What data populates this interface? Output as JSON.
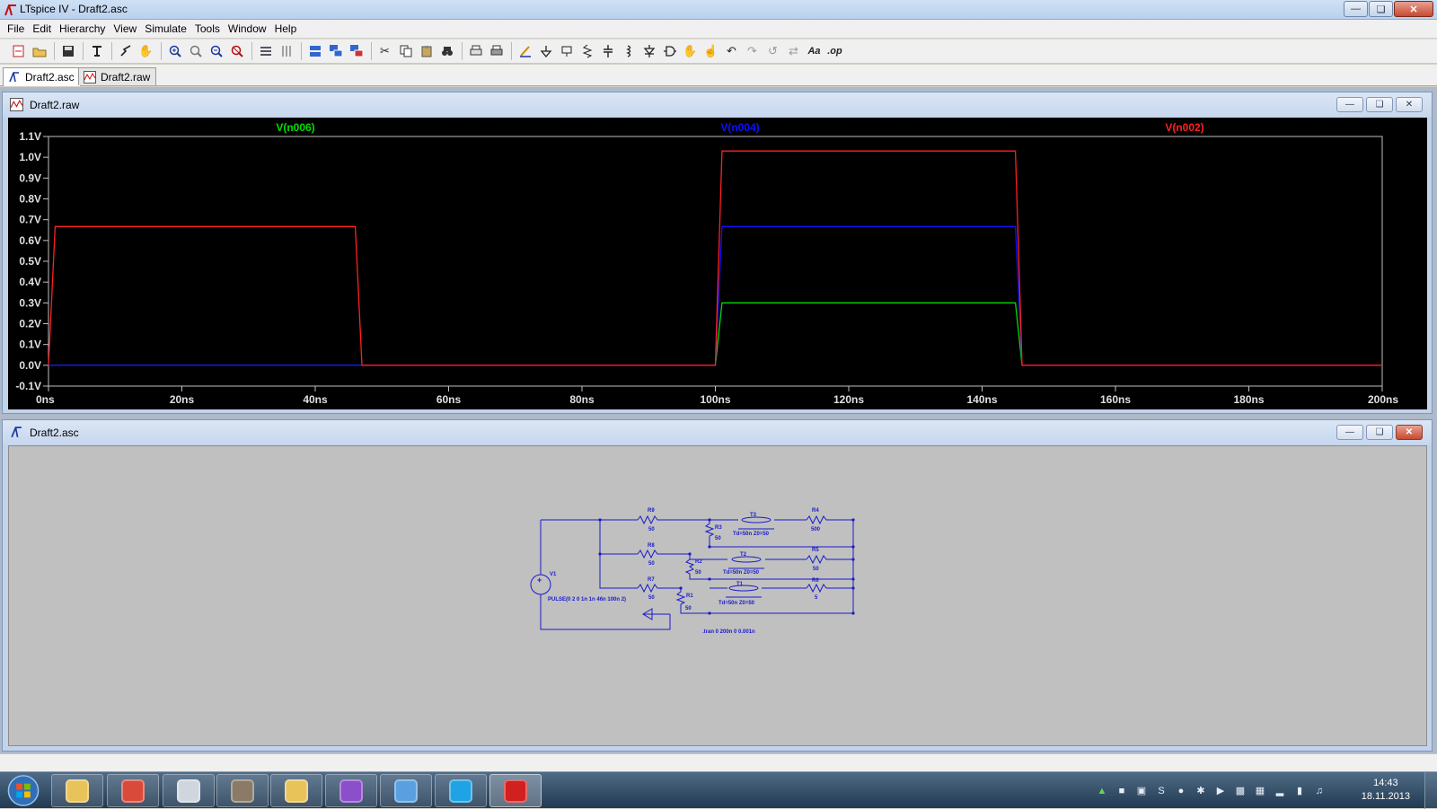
{
  "app": {
    "title": "LTspice IV - Draft2.asc"
  },
  "menu": [
    "File",
    "Edit",
    "Hierarchy",
    "View",
    "Simulate",
    "Tools",
    "Window",
    "Help"
  ],
  "toolbar": {
    "text_tool_label": "Aa",
    "spice_directive_label": ".op"
  },
  "tabs": [
    {
      "label": "Draft2.asc",
      "icon": "schematic-icon",
      "active": true
    },
    {
      "label": "Draft2.raw",
      "icon": "waveform-icon",
      "active": false
    }
  ],
  "plot_window": {
    "title": "Draft2.raw"
  },
  "schematic_window": {
    "title": "Draft2.asc"
  },
  "chart_data": {
    "type": "line",
    "xlabel": "",
    "ylabel": "",
    "x_ticks": [
      "0ns",
      "20ns",
      "40ns",
      "60ns",
      "80ns",
      "100ns",
      "120ns",
      "140ns",
      "160ns",
      "180ns",
      "200ns"
    ],
    "y_ticks": [
      "1.1V",
      "1.0V",
      "0.9V",
      "0.8V",
      "0.7V",
      "0.6V",
      "0.5V",
      "0.4V",
      "0.3V",
      "0.2V",
      "0.1V",
      "0.0V",
      "-0.1V"
    ],
    "xlim": [
      0,
      200
    ],
    "ylim": [
      -0.1,
      1.1
    ],
    "grid": false,
    "background": "#000000",
    "series": [
      {
        "name": "V(n006)",
        "color": "#00dd00",
        "x": [
          0,
          100,
          101,
          145,
          146,
          200
        ],
        "y": [
          0,
          0,
          0.3,
          0.3,
          0,
          0
        ]
      },
      {
        "name": "V(n004)",
        "color": "#1010ff",
        "x": [
          0,
          100,
          101,
          145,
          146,
          200
        ],
        "y": [
          0,
          0,
          0.667,
          0.667,
          0,
          0
        ]
      },
      {
        "name": "V(n002)",
        "color": "#ff2020",
        "x": [
          0,
          1,
          46,
          47,
          100,
          101,
          145,
          146,
          200
        ],
        "y": [
          0,
          0.667,
          0.667,
          0,
          0,
          1.03,
          1.03,
          0,
          0
        ]
      }
    ]
  },
  "schematic": {
    "wire_color": "#1a1acc",
    "labels": {
      "v1": "V1",
      "v1_value": "PULSE(0 2 0 1n 1n 46n 100n 2)",
      "r9": "R9",
      "r9_value": "50",
      "r8": "R8",
      "r8_value": "50",
      "r7": "R7",
      "r7_value": "50",
      "r3": "R3",
      "r3_value": "50",
      "r2": "R2",
      "r2_value": "50",
      "r1": "R1",
      "r1_value": "50",
      "t3": "T3",
      "t3_value": "Td=50n Z0=50",
      "t2": "T2",
      "t2_value": "Td=50n Z0=50",
      "t1": "T1",
      "t1_value": "Td=50n Z0=50",
      "r4": "R4",
      "r4_value": "500",
      "r5": "R5",
      "r5_value": "50",
      "r6": "R6",
      "r6_value": "5",
      "tran": ".tran 0 200n 0 0.001n"
    }
  },
  "taskbar": {
    "apps": [
      {
        "name": "explorer-icon",
        "color": "#e8c35a"
      },
      {
        "name": "chrome-icon",
        "color": "#d94a3a"
      },
      {
        "name": "usb-drive-icon",
        "color": "#cfd6de"
      },
      {
        "name": "gimp-icon",
        "color": "#8a7a66"
      },
      {
        "name": "outlook-icon",
        "color": "#e8c35a"
      },
      {
        "name": "visual-studio-icon",
        "color": "#8a4fc9"
      },
      {
        "name": "paint-icon",
        "color": "#5aa0e0"
      },
      {
        "name": "skype-icon",
        "color": "#1fa3e5"
      },
      {
        "name": "ltspice-icon",
        "color": "#d02020"
      }
    ],
    "clock_time": "14:43",
    "clock_date": "18.11.2013"
  }
}
